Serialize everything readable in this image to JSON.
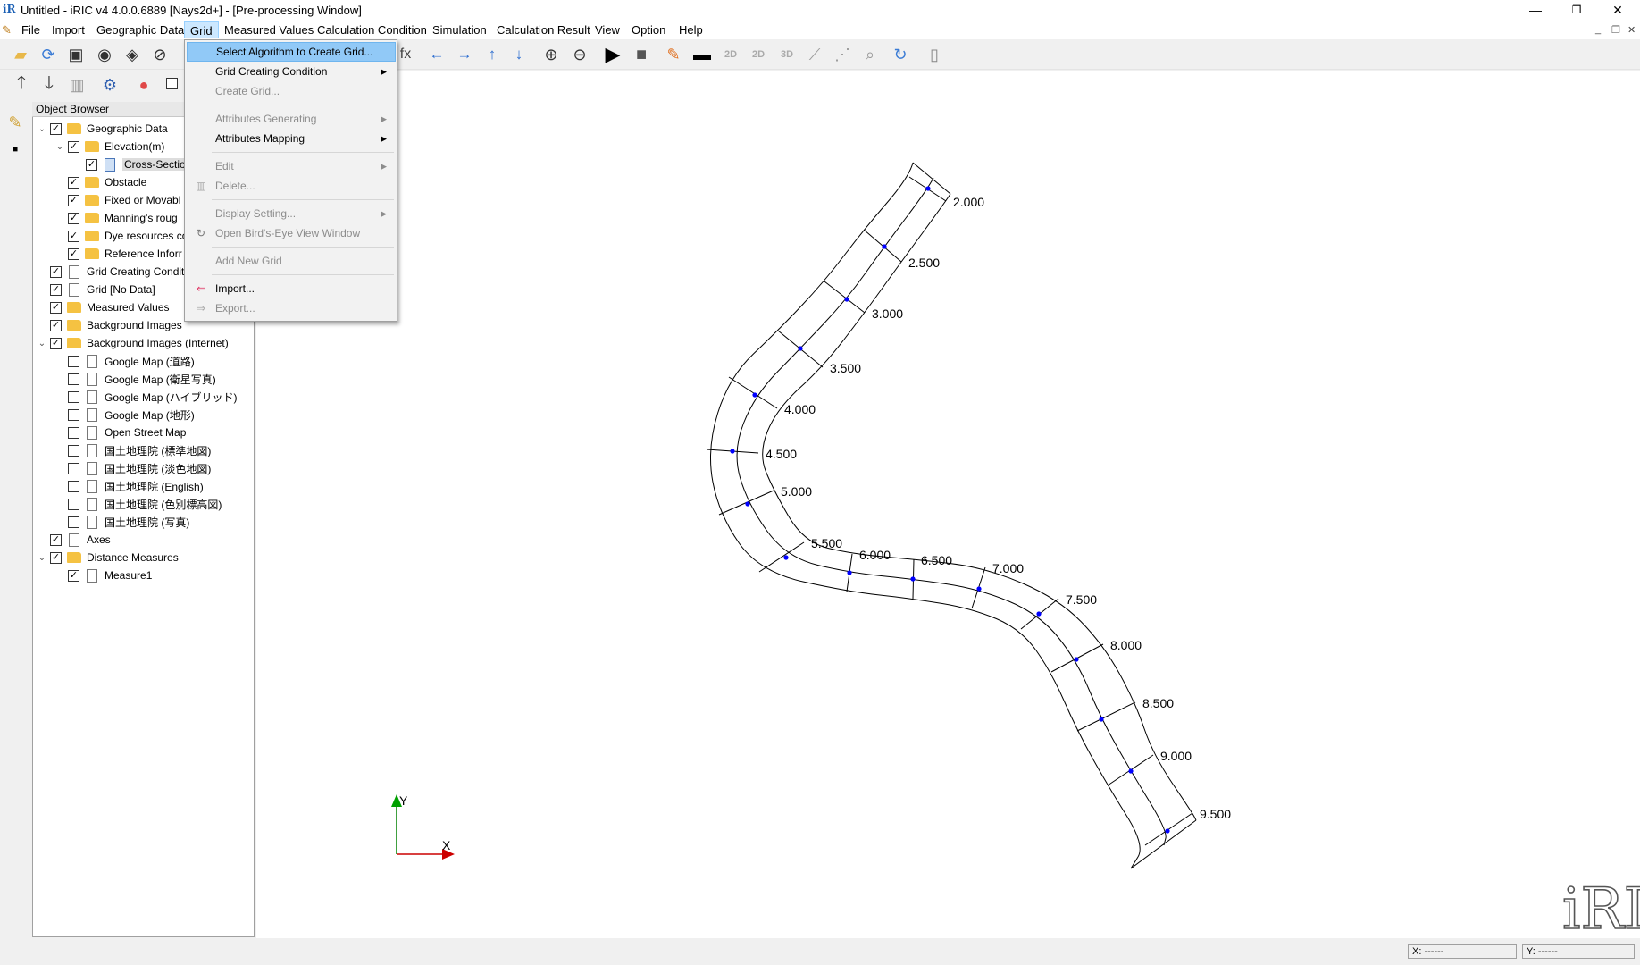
{
  "window": {
    "title": "Untitled - iRIC v4 4.0.0.6889 [Nays2d+] - [Pre-processing Window]",
    "icon": "iric-logo-icon",
    "minimize": "—",
    "restore": "❐",
    "close": "✕"
  },
  "menubar": {
    "items": [
      "File",
      "Import",
      "Geographic Data",
      "Grid",
      "Measured Values",
      "Calculation Condition",
      "Simulation",
      "Calculation Result",
      "View",
      "Option",
      "Help"
    ],
    "active": "Grid",
    "mdi_minimize": "_",
    "mdi_restore": "❐",
    "mdi_close": "✕"
  },
  "grid_menu": {
    "items": [
      {
        "label": "Select Algorithm to Create Grid...",
        "enabled": true,
        "highlighted": true
      },
      {
        "label": "Grid Creating Condition",
        "enabled": true,
        "submenu": true
      },
      {
        "label": "Create Grid...",
        "enabled": false
      },
      {
        "label": "Attributes Generating",
        "enabled": false,
        "submenu": true
      },
      {
        "label": "Attributes Mapping",
        "enabled": true,
        "submenu": true
      },
      {
        "label": "Edit",
        "enabled": false,
        "submenu": true
      },
      {
        "label": "Delete...",
        "enabled": false,
        "icon": "trash-icon"
      },
      {
        "label": "Display Setting...",
        "enabled": false,
        "submenu": true
      },
      {
        "label": "Open Bird's-Eye View Window",
        "enabled": false,
        "icon": "birds-eye-icon"
      },
      {
        "label": "Add New Grid",
        "enabled": false
      },
      {
        "label": "Import...",
        "enabled": true,
        "icon": "import-icon"
      },
      {
        "label": "Export...",
        "enabled": false,
        "icon": "export-icon"
      }
    ]
  },
  "object_browser": {
    "title": "Object Browser",
    "items": [
      {
        "label": "Geographic Data",
        "level": 0,
        "expanded": true,
        "checked": true,
        "icon": "folder"
      },
      {
        "label": "Elevation(m)",
        "level": 1,
        "expanded": true,
        "checked": true,
        "icon": "folder"
      },
      {
        "label": "Cross-Sectio",
        "level": 2,
        "checked": true,
        "icon": "doc-blue",
        "selected": true
      },
      {
        "label": "Obstacle",
        "level": 1,
        "checked": true,
        "icon": "folder"
      },
      {
        "label": "Fixed or Movabl",
        "level": 1,
        "checked": true,
        "icon": "folder"
      },
      {
        "label": "Manning's roug",
        "level": 1,
        "checked": true,
        "icon": "folder"
      },
      {
        "label": "Dye resources co",
        "level": 1,
        "checked": true,
        "icon": "folder"
      },
      {
        "label": "Reference Inforr",
        "level": 1,
        "checked": true,
        "icon": "folder"
      },
      {
        "label": "Grid Creating Condit",
        "level": 0,
        "checked": true,
        "icon": "doc"
      },
      {
        "label": "Grid [No Data]",
        "level": 0,
        "checked": true,
        "icon": "doc"
      },
      {
        "label": "Measured Values",
        "level": 0,
        "checked": true,
        "icon": "folder"
      },
      {
        "label": "Background Images",
        "level": 0,
        "checked": true,
        "icon": "folder"
      },
      {
        "label": "Background Images (Internet)",
        "level": 0,
        "expanded": true,
        "checked": true,
        "icon": "folder"
      },
      {
        "label": "Google Map (道路)",
        "level": 1,
        "checked": false,
        "icon": "doc"
      },
      {
        "label": "Google Map (衛星写真)",
        "level": 1,
        "checked": false,
        "icon": "doc"
      },
      {
        "label": "Google Map (ハイブリッド)",
        "level": 1,
        "checked": false,
        "icon": "doc"
      },
      {
        "label": "Google Map (地形)",
        "level": 1,
        "checked": false,
        "icon": "doc"
      },
      {
        "label": "Open Street Map",
        "level": 1,
        "checked": false,
        "icon": "doc"
      },
      {
        "label": "国土地理院 (標準地図)",
        "level": 1,
        "checked": false,
        "icon": "doc"
      },
      {
        "label": "国土地理院 (淡色地図)",
        "level": 1,
        "checked": false,
        "icon": "doc"
      },
      {
        "label": "国土地理院 (English)",
        "level": 1,
        "checked": false,
        "icon": "doc"
      },
      {
        "label": "国土地理院 (色別標高図)",
        "level": 1,
        "checked": false,
        "icon": "doc"
      },
      {
        "label": "国土地理院 (写真)",
        "level": 1,
        "checked": false,
        "icon": "doc"
      },
      {
        "label": "Axes",
        "level": 0,
        "checked": true,
        "icon": "doc"
      },
      {
        "label": "Distance Measures",
        "level": 0,
        "expanded": true,
        "checked": true,
        "icon": "folder"
      },
      {
        "label": "Measure1",
        "level": 1,
        "checked": true,
        "icon": "doc"
      }
    ]
  },
  "canvas": {
    "cross_section_labels": [
      "2.000",
      "2.500",
      "3.000",
      "3.500",
      "4.000",
      "4.500",
      "5.000",
      "5.500",
      "6.000",
      "6.500",
      "7.000",
      "7.500",
      "8.000",
      "8.500",
      "9.000",
      "9.500"
    ],
    "axis_x_label": "X",
    "axis_y_label": "Y",
    "logo_text": "iRIC"
  },
  "statusbar": {
    "x_field": "X: ------",
    "y_field": "Y: ------"
  },
  "colors": {
    "menu_highlight": "#91c9f7",
    "grid_line": "#000000",
    "grid_point": "#0000ff",
    "axis_x": "#cc0000",
    "axis_y": "#008000"
  }
}
